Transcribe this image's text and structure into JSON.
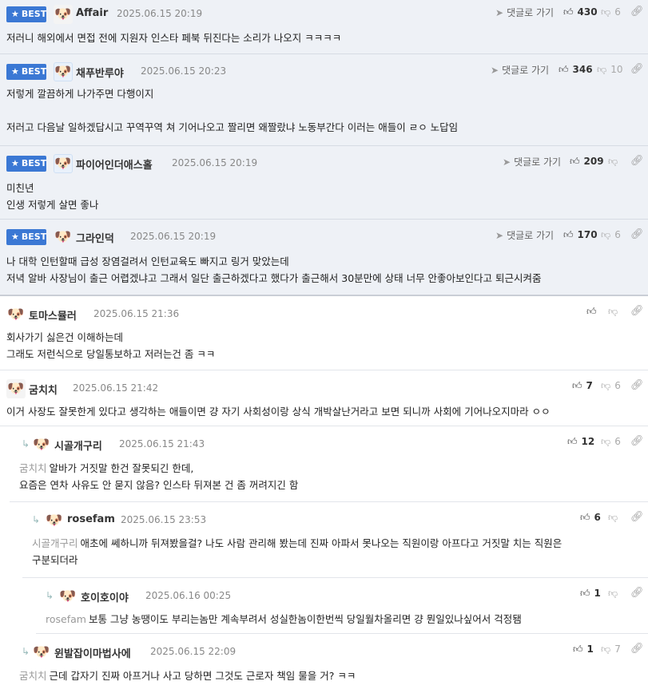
{
  "best_label": "BEST",
  "reply_label": "댓글로 가기",
  "comments": [
    {
      "nick": "Affair",
      "date": "2025.06.15 20:19",
      "up": "430",
      "down": "6",
      "lines": [
        "저러니 해외에서 면접 전에 지원자 인스타 페북 뒤진다는 소리가 나오지 ㅋㅋㅋㅋ"
      ]
    },
    {
      "nick": "채푸반루야",
      "date": "2025.06.15 20:23",
      "up": "346",
      "down": "10",
      "lines": [
        "저렇게 깔끔하게 나가주면 다행이지",
        "저러고 다음날 일하겠답시고 꾸역꾸역 쳐 기어나오고 짤리면 왜짤랐냐 노동부간다 이러는 애들이 ㄹㅇ 노답임"
      ]
    },
    {
      "nick": "파이어인더애스홀",
      "date": "2025.06.15 20:19",
      "up": "209",
      "lines": [
        "미친년",
        "인생 저렇게 살면 좋나"
      ]
    },
    {
      "nick": "그라인덕",
      "date": "2025.06.15 20:19",
      "up": "170",
      "down": "6",
      "lines": [
        "나 대학 인턴할때 급성 장염걸려서 인턴교육도 빠지고 링거 맞았는데",
        "저녁 알바 사장님이 출근 어렵겠냐고 그래서 일단 출근하겠다고 했다가 출근해서 30분만에 상태 너무 안좋아보인다고 퇴근시켜줌"
      ]
    },
    {
      "nick": "토마스뮬러",
      "date": "2025.06.15 21:36",
      "lines": [
        "회사가기 싫은건 이해하는데",
        "그래도 저런식으로 당일통보하고 저러는건 좀 ㅋㅋ"
      ]
    },
    {
      "nick": "굼치치",
      "date": "2025.06.15 21:42",
      "up": "7",
      "down": "6",
      "lines": [
        "이거 사장도 잘못한게 있다고 생각하는 애들이면 걍 자기 사회성이랑 상식 개박살난거라고 보면 되니까 사회에 기어나오지마라 ㅇㅇ"
      ]
    },
    {
      "nick": "시골개구리",
      "date": "2025.06.15 21:43",
      "up": "12",
      "down": "6",
      "mention": "굼치치",
      "lines": [
        "알바가 거짓말 한건 잘못되긴 한데,",
        "요즘은 연차 사유도 안 묻지 않음? 인스타 뒤져본 건 좀 꺼려지긴 함"
      ]
    },
    {
      "nick": "rosefam",
      "date": "2025.06.15 23:53",
      "up": "6",
      "mention": "시골개구리",
      "lines": [
        "애초에 쎄하니까 뒤져봤을걸? 나도 사람 관리해 봤는데 진짜 아파서 못나오는 직원이랑 아프다고 거짓말 치는 직원은",
        "구분되더라"
      ]
    },
    {
      "nick": "호이호이야",
      "date": "2025.06.16 00:25",
      "up": "1",
      "mention": "rosefam",
      "lines": [
        "보통 그냥 농땡이도 부리는놈만 계속부려서 성실한놈이한번씩 당일월차올리면 걍 뭔일있나싶어서 걱정됌"
      ]
    },
    {
      "nick": "윈발잡이마법사에",
      "date": "2025.06.15 22:09",
      "up": "1",
      "down": "7",
      "mention": "굼치치",
      "lines": [
        "근데 갑자기 진짜 아프거나 사고 당하면 그것도 근로자 책임 물을 거? ㅋㅋ"
      ]
    }
  ]
}
